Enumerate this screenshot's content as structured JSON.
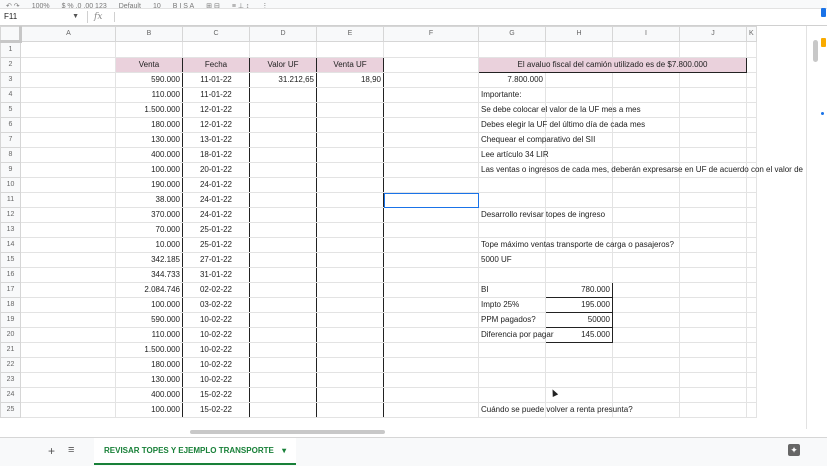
{
  "toolbar": {
    "items": [
      "↶ ↷",
      "100%",
      "$ % .0 .00 123",
      "Default",
      "10",
      "B I S A",
      "⊞ ⊟",
      "≡ ⊥ ↕",
      "⋮"
    ]
  },
  "formula_bar": {
    "cell_ref": "F11",
    "fx": "fx"
  },
  "columns": [
    "A",
    "B",
    "C",
    "D",
    "E",
    "F",
    "G",
    "H",
    "I",
    "J",
    "K"
  ],
  "rows": [
    {
      "n": "1",
      "b": "",
      "c": "",
      "d": "",
      "e": ""
    },
    {
      "n": "2",
      "b": "Venta",
      "c": "Fecha",
      "d": "Valor UF",
      "e": "Venta UF"
    },
    {
      "n": "3",
      "b": "590.000",
      "c": "11-01-22",
      "d": "31.212,65",
      "e": "18,90"
    },
    {
      "n": "4",
      "b": "110.000",
      "c": "11-01-22",
      "d": "",
      "e": ""
    },
    {
      "n": "5",
      "b": "1.500.000",
      "c": "12-01-22",
      "d": "",
      "e": ""
    },
    {
      "n": "6",
      "b": "180.000",
      "c": "12-01-22",
      "d": "",
      "e": ""
    },
    {
      "n": "7",
      "b": "130.000",
      "c": "13-01-22",
      "d": "",
      "e": ""
    },
    {
      "n": "8",
      "b": "400.000",
      "c": "18-01-22",
      "d": "",
      "e": ""
    },
    {
      "n": "9",
      "b": "100.000",
      "c": "20-01-22",
      "d": "",
      "e": ""
    },
    {
      "n": "10",
      "b": "190.000",
      "c": "24-01-22",
      "d": "",
      "e": ""
    },
    {
      "n": "11",
      "b": "38.000",
      "c": "24-01-22",
      "d": "",
      "e": ""
    },
    {
      "n": "12",
      "b": "370.000",
      "c": "24-01-22",
      "d": "",
      "e": ""
    },
    {
      "n": "13",
      "b": "70.000",
      "c": "25-01-22",
      "d": "",
      "e": ""
    },
    {
      "n": "14",
      "b": "10.000",
      "c": "25-01-22",
      "d": "",
      "e": ""
    },
    {
      "n": "15",
      "b": "342.185",
      "c": "27-01-22",
      "d": "",
      "e": ""
    },
    {
      "n": "16",
      "b": "344.733",
      "c": "31-01-22",
      "d": "",
      "e": ""
    },
    {
      "n": "17",
      "b": "2.084.746",
      "c": "02-02-22",
      "d": "",
      "e": ""
    },
    {
      "n": "18",
      "b": "100.000",
      "c": "03-02-22",
      "d": "",
      "e": ""
    },
    {
      "n": "19",
      "b": "590.000",
      "c": "10-02-22",
      "d": "",
      "e": ""
    },
    {
      "n": "20",
      "b": "110.000",
      "c": "10-02-22",
      "d": "",
      "e": ""
    },
    {
      "n": "21",
      "b": "1.500.000",
      "c": "10-02-22",
      "d": "",
      "e": ""
    },
    {
      "n": "22",
      "b": "180.000",
      "c": "10-02-22",
      "d": "",
      "e": ""
    },
    {
      "n": "23",
      "b": "130.000",
      "c": "10-02-22",
      "d": "",
      "e": ""
    },
    {
      "n": "24",
      "b": "400.000",
      "c": "15-02-22",
      "d": "",
      "e": ""
    },
    {
      "n": "25",
      "b": "100.000",
      "c": "15-02-22",
      "d": "",
      "e": ""
    }
  ],
  "notes": {
    "g2": "El avaluo fiscal del camión utilizado es de $7.800.000",
    "g3": "7.800.000",
    "g4": "Importante:",
    "g5": "Se debe colocar el valor de la UF mes a mes",
    "g6": "Debes elegir la UF del último día de cada mes",
    "g7": "Chequear el comparativo del SII",
    "g8": "Lee artículo 34 LIR",
    "g9": "Las ventas o ingresos de cada mes, deberán expresarse en UF de acuerdo con el valor de",
    "g12": "Desarrollo revisar topes de ingreso",
    "g14": "Tope máximo ventas transporte de carga o pasajeros?",
    "g15": "5000 UF",
    "g17": "BI",
    "h17": "780.000",
    "g18": "Impto 25%",
    "h18": "195.000",
    "g19": "PPM pagados?",
    "h19": "50000",
    "g20": "Diferencia por pagar",
    "h20": "145.000",
    "g25": "Cuándo se puede volver a renta presunta?"
  },
  "sheet_tab": {
    "label": "REVISAR TOPES Y EJEMPLO TRANSPORTE",
    "caret": "▾"
  },
  "sheetbar": {
    "add": "+",
    "list": "≡"
  },
  "colors": {
    "header_fill": "#ead1dc",
    "tab_green": "#188038",
    "selection": "#1a73e8"
  }
}
